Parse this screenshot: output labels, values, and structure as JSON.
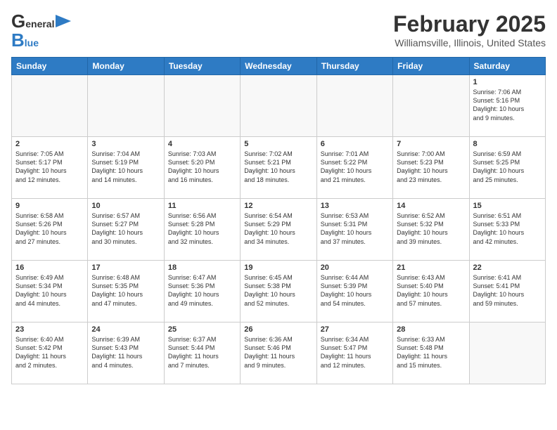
{
  "header": {
    "logo_top": "General",
    "logo_bottom": "Blue",
    "title": "February 2025",
    "subtitle": "Williamsville, Illinois, United States"
  },
  "days_of_week": [
    "Sunday",
    "Monday",
    "Tuesday",
    "Wednesday",
    "Thursday",
    "Friday",
    "Saturday"
  ],
  "weeks": [
    [
      {
        "day": "",
        "info": ""
      },
      {
        "day": "",
        "info": ""
      },
      {
        "day": "",
        "info": ""
      },
      {
        "day": "",
        "info": ""
      },
      {
        "day": "",
        "info": ""
      },
      {
        "day": "",
        "info": ""
      },
      {
        "day": "1",
        "info": "Sunrise: 7:06 AM\nSunset: 5:16 PM\nDaylight: 10 hours\nand 9 minutes."
      }
    ],
    [
      {
        "day": "2",
        "info": "Sunrise: 7:05 AM\nSunset: 5:17 PM\nDaylight: 10 hours\nand 12 minutes."
      },
      {
        "day": "3",
        "info": "Sunrise: 7:04 AM\nSunset: 5:19 PM\nDaylight: 10 hours\nand 14 minutes."
      },
      {
        "day": "4",
        "info": "Sunrise: 7:03 AM\nSunset: 5:20 PM\nDaylight: 10 hours\nand 16 minutes."
      },
      {
        "day": "5",
        "info": "Sunrise: 7:02 AM\nSunset: 5:21 PM\nDaylight: 10 hours\nand 18 minutes."
      },
      {
        "day": "6",
        "info": "Sunrise: 7:01 AM\nSunset: 5:22 PM\nDaylight: 10 hours\nand 21 minutes."
      },
      {
        "day": "7",
        "info": "Sunrise: 7:00 AM\nSunset: 5:23 PM\nDaylight: 10 hours\nand 23 minutes."
      },
      {
        "day": "8",
        "info": "Sunrise: 6:59 AM\nSunset: 5:25 PM\nDaylight: 10 hours\nand 25 minutes."
      }
    ],
    [
      {
        "day": "9",
        "info": "Sunrise: 6:58 AM\nSunset: 5:26 PM\nDaylight: 10 hours\nand 27 minutes."
      },
      {
        "day": "10",
        "info": "Sunrise: 6:57 AM\nSunset: 5:27 PM\nDaylight: 10 hours\nand 30 minutes."
      },
      {
        "day": "11",
        "info": "Sunrise: 6:56 AM\nSunset: 5:28 PM\nDaylight: 10 hours\nand 32 minutes."
      },
      {
        "day": "12",
        "info": "Sunrise: 6:54 AM\nSunset: 5:29 PM\nDaylight: 10 hours\nand 34 minutes."
      },
      {
        "day": "13",
        "info": "Sunrise: 6:53 AM\nSunset: 5:31 PM\nDaylight: 10 hours\nand 37 minutes."
      },
      {
        "day": "14",
        "info": "Sunrise: 6:52 AM\nSunset: 5:32 PM\nDaylight: 10 hours\nand 39 minutes."
      },
      {
        "day": "15",
        "info": "Sunrise: 6:51 AM\nSunset: 5:33 PM\nDaylight: 10 hours\nand 42 minutes."
      }
    ],
    [
      {
        "day": "16",
        "info": "Sunrise: 6:49 AM\nSunset: 5:34 PM\nDaylight: 10 hours\nand 44 minutes."
      },
      {
        "day": "17",
        "info": "Sunrise: 6:48 AM\nSunset: 5:35 PM\nDaylight: 10 hours\nand 47 minutes."
      },
      {
        "day": "18",
        "info": "Sunrise: 6:47 AM\nSunset: 5:36 PM\nDaylight: 10 hours\nand 49 minutes."
      },
      {
        "day": "19",
        "info": "Sunrise: 6:45 AM\nSunset: 5:38 PM\nDaylight: 10 hours\nand 52 minutes."
      },
      {
        "day": "20",
        "info": "Sunrise: 6:44 AM\nSunset: 5:39 PM\nDaylight: 10 hours\nand 54 minutes."
      },
      {
        "day": "21",
        "info": "Sunrise: 6:43 AM\nSunset: 5:40 PM\nDaylight: 10 hours\nand 57 minutes."
      },
      {
        "day": "22",
        "info": "Sunrise: 6:41 AM\nSunset: 5:41 PM\nDaylight: 10 hours\nand 59 minutes."
      }
    ],
    [
      {
        "day": "23",
        "info": "Sunrise: 6:40 AM\nSunset: 5:42 PM\nDaylight: 11 hours\nand 2 minutes."
      },
      {
        "day": "24",
        "info": "Sunrise: 6:39 AM\nSunset: 5:43 PM\nDaylight: 11 hours\nand 4 minutes."
      },
      {
        "day": "25",
        "info": "Sunrise: 6:37 AM\nSunset: 5:44 PM\nDaylight: 11 hours\nand 7 minutes."
      },
      {
        "day": "26",
        "info": "Sunrise: 6:36 AM\nSunset: 5:46 PM\nDaylight: 11 hours\nand 9 minutes."
      },
      {
        "day": "27",
        "info": "Sunrise: 6:34 AM\nSunset: 5:47 PM\nDaylight: 11 hours\nand 12 minutes."
      },
      {
        "day": "28",
        "info": "Sunrise: 6:33 AM\nSunset: 5:48 PM\nDaylight: 11 hours\nand 15 minutes."
      },
      {
        "day": "",
        "info": ""
      }
    ]
  ]
}
